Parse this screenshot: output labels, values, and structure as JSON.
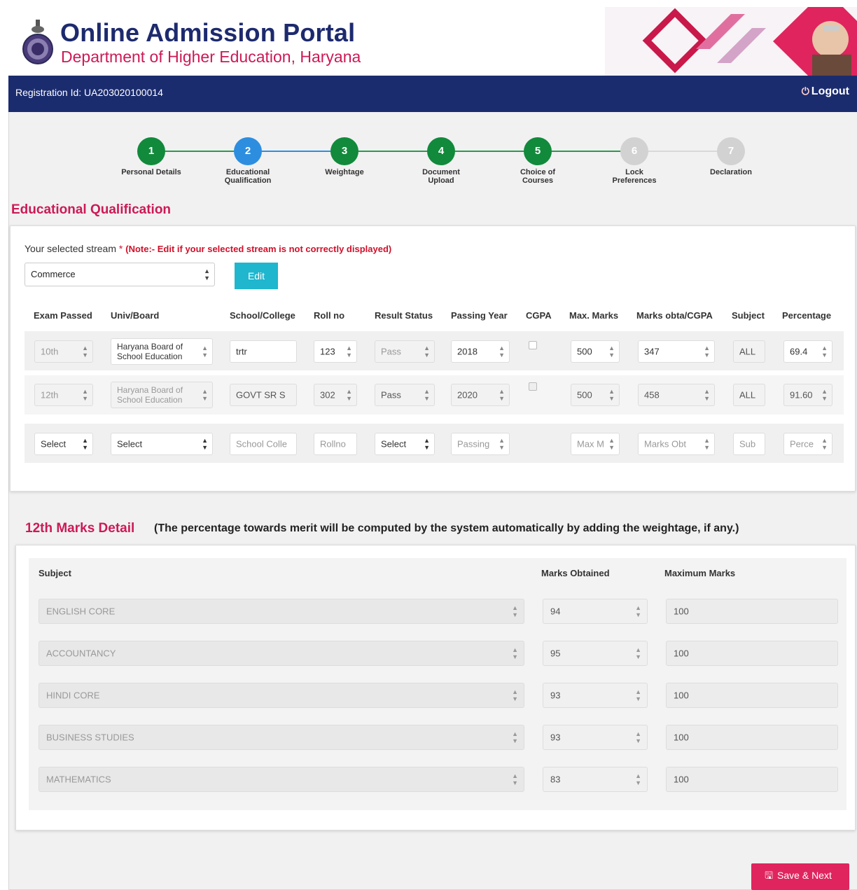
{
  "header": {
    "title": "Online Admission Portal",
    "subtitle": "Department of Higher Education, Haryana",
    "brand_color": "#1d2a6e",
    "accent_color": "#cc1a55"
  },
  "topbar": {
    "registration": "Registration Id: UA203020100014",
    "logout": "Logout",
    "logout_icon": "power-icon"
  },
  "steps": [
    {
      "num": "1",
      "label": "Personal Details",
      "state": "done"
    },
    {
      "num": "2",
      "label": "Educational Qualification",
      "state": "current"
    },
    {
      "num": "3",
      "label": "Weightage",
      "state": "done"
    },
    {
      "num": "4",
      "label": "Document Upload",
      "state": "done"
    },
    {
      "num": "5",
      "label": "Choice of Courses",
      "state": "done"
    },
    {
      "num": "6",
      "label": "Lock Preferences",
      "state": "pending"
    },
    {
      "num": "7",
      "label": "Declaration",
      "state": "pending"
    }
  ],
  "section_title": "Educational Qualification",
  "stream": {
    "label": "Your selected stream",
    "star": "*",
    "note": "(Note:- Edit if your selected stream is not correctly displayed)",
    "value": "Commerce",
    "edit": "Edit"
  },
  "qual_table": {
    "headers": [
      "Exam Passed",
      "Univ/Board",
      "School/College",
      "Roll no",
      "Result Status",
      "Passing Year",
      "CGPA",
      "Max. Marks",
      "Marks obta/CGPA",
      "Subject",
      "Percentage"
    ],
    "rows": [
      {
        "exam": "10th",
        "board": "Haryana Board of School Education",
        "school": "trtr",
        "roll": "123",
        "result": "Pass",
        "year": "2018",
        "max": "500",
        "obtained": "347",
        "subject": "ALL",
        "percentage": "69.4"
      },
      {
        "exam": "12th",
        "board": "Haryana Board of School Education",
        "school": "GOVT SR S",
        "roll": "302",
        "result": "Pass",
        "year": "2020",
        "max": "500",
        "obtained": "458",
        "subject": "ALL",
        "percentage": "91.60"
      }
    ],
    "new_row": {
      "exam": "Select",
      "board": "Select",
      "school": "School Colle",
      "roll": "Rollno",
      "result": "Select",
      "year": "Passing",
      "max": "Max M",
      "obtained": "Marks Obt",
      "subject": "Sub",
      "percentage": "Perce"
    }
  },
  "marks": {
    "heading": "12th Marks Detail",
    "note": "(The percentage towards merit will be computed by the system automatically by adding the weightage, if any.)",
    "headers": {
      "subject": "Subject",
      "obtained": "Marks Obtained",
      "maximum": "Maximum Marks"
    },
    "rows": [
      {
        "subject": "ENGLISH CORE",
        "obtained": "94",
        "max": "100"
      },
      {
        "subject": "ACCOUNTANCY",
        "obtained": "95",
        "max": "100"
      },
      {
        "subject": "HINDI CORE",
        "obtained": "93",
        "max": "100"
      },
      {
        "subject": "BUSINESS STUDIES",
        "obtained": "93",
        "max": "100"
      },
      {
        "subject": "MATHEMATICS",
        "obtained": "83",
        "max": "100"
      }
    ]
  },
  "save_button": "Save & Next",
  "save_icon": "floppy-disk-icon"
}
